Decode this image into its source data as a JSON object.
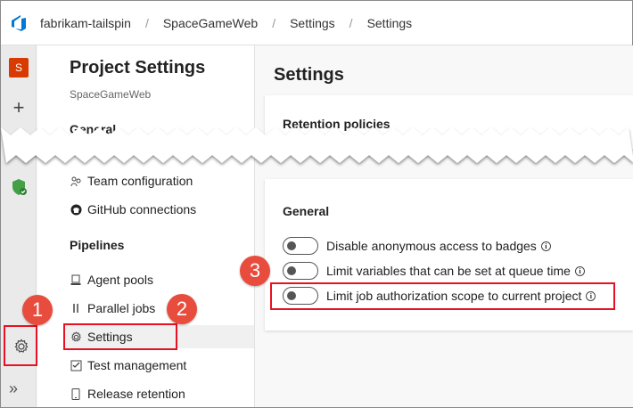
{
  "breadcrumb": [
    "fabrikam-tailspin",
    "SpaceGameWeb",
    "Settings",
    "Settings"
  ],
  "rail": {
    "project_initial": "S",
    "collapse_glyph": "»"
  },
  "nav": {
    "title": "Project Settings",
    "subtitle": "SpaceGameWeb",
    "general_partial": "General",
    "items_top": [
      {
        "label": "Team configuration",
        "icon": "team-icon"
      },
      {
        "label": "GitHub connections",
        "icon": "github-icon"
      }
    ],
    "pipelines_heading": "Pipelines",
    "pipeline_items": [
      {
        "label": "Agent pools",
        "icon": "agent-pool-icon"
      },
      {
        "label": "Parallel jobs",
        "icon": "parallel-icon"
      },
      {
        "label": "Settings",
        "icon": "gear-icon",
        "selected": true
      },
      {
        "label": "Test management",
        "icon": "test-management-icon"
      },
      {
        "label": "Release retention",
        "icon": "phone-icon"
      }
    ]
  },
  "main": {
    "title": "Settings",
    "top_card_title": "Retention policies",
    "card_title": "General",
    "toggles": [
      {
        "label": "Disable anonymous access to badges",
        "on": false
      },
      {
        "label": "Limit variables that can be set at queue time",
        "on": false
      },
      {
        "label": "Limit job authorization scope to current project",
        "on": false
      }
    ]
  },
  "callouts": [
    "1",
    "2",
    "3"
  ],
  "colors": {
    "callout": "#e84c3d",
    "highlight_box": "#e81123",
    "project_badge": "#d83b01",
    "brand": "#0078d4"
  }
}
